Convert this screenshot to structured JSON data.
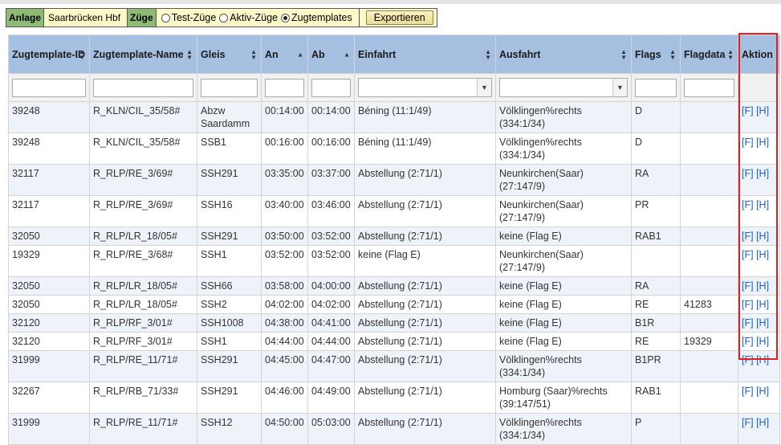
{
  "toolbar": {
    "anlage_label": "Anlage",
    "anlage_value": "Saarbrücken Hbf",
    "zuege_label": "Züge",
    "radio_test": "Test-Züge",
    "radio_aktiv": "Aktiv-Züge",
    "radio_templates": "Zugtemplates",
    "selected_radio": "Zugtemplates",
    "export_label": "Exportieren"
  },
  "table": {
    "headers": {
      "id": "Zugtemplate-ID",
      "name": "Zugtemplate-Name",
      "gleis": "Gleis",
      "an": "An",
      "ab": "Ab",
      "einfahrt": "Einfahrt",
      "ausfahrt": "Ausfahrt",
      "flags": "Flags",
      "flagdata": "Flagdata",
      "aktion": "Aktion"
    },
    "action_f": "[F]",
    "action_h": "[H]",
    "rows": [
      {
        "id": "39248",
        "name": "R_KLN/CIL_35/58#",
        "gleis": "Abzw Saardamm",
        "an": "00:14:00",
        "ab": "00:14:00",
        "einfahrt": "Béning (11:1/49)",
        "ausfahrt": "Völklingen%rechts (334:1/34)",
        "flags": "D",
        "flagdata": ""
      },
      {
        "id": "39248",
        "name": "R_KLN/CIL_35/58#",
        "gleis": "SSB1",
        "an": "00:16:00",
        "ab": "00:16:00",
        "einfahrt": "Béning (11:1/49)",
        "ausfahrt": "Völklingen%rechts (334:1/34)",
        "flags": "D",
        "flagdata": ""
      },
      {
        "id": "32117",
        "name": "R_RLP/RE_3/69#",
        "gleis": "SSH291",
        "an": "03:35:00",
        "ab": "03:37:00",
        "einfahrt": "Abstellung (2:71/1)",
        "ausfahrt": "Neunkirchen(Saar) (27:147/9)",
        "flags": "RA",
        "flagdata": ""
      },
      {
        "id": "32117",
        "name": "R_RLP/RE_3/69#",
        "gleis": "SSH16",
        "an": "03:40:00",
        "ab": "03:46:00",
        "einfahrt": "Abstellung (2:71/1)",
        "ausfahrt": "Neunkirchen(Saar) (27:147/9)",
        "flags": "PR",
        "flagdata": ""
      },
      {
        "id": "32050",
        "name": "R_RLP/LR_18/05#",
        "gleis": "SSH291",
        "an": "03:50:00",
        "ab": "03:52:00",
        "einfahrt": "Abstellung (2:71/1)",
        "ausfahrt": "keine (Flag E)",
        "flags": "RAB1",
        "flagdata": ""
      },
      {
        "id": "19329",
        "name": "R_RLP/RE_3/68#",
        "gleis": "SSH1",
        "an": "03:52:00",
        "ab": "03:52:00",
        "einfahrt": "keine (Flag E)",
        "ausfahrt": "Neunkirchen(Saar) (27:147/9)",
        "flags": "",
        "flagdata": ""
      },
      {
        "id": "32050",
        "name": "R_RLP/LR_18/05#",
        "gleis": "SSH66",
        "an": "03:58:00",
        "ab": "04:00:00",
        "einfahrt": "Abstellung (2:71/1)",
        "ausfahrt": "keine (Flag E)",
        "flags": "RA",
        "flagdata": ""
      },
      {
        "id": "32050",
        "name": "R_RLP/LR_18/05#",
        "gleis": "SSH2",
        "an": "04:02:00",
        "ab": "04:02:00",
        "einfahrt": "Abstellung (2:71/1)",
        "ausfahrt": "keine (Flag E)",
        "flags": "RE",
        "flagdata": "41283"
      },
      {
        "id": "32120",
        "name": "R_RLP/RF_3/01#",
        "gleis": "SSH1008",
        "an": "04:38:00",
        "ab": "04:41:00",
        "einfahrt": "Abstellung (2:71/1)",
        "ausfahrt": "keine (Flag E)",
        "flags": "B1R",
        "flagdata": ""
      },
      {
        "id": "32120",
        "name": "R_RLP/RF_3/01#",
        "gleis": "SSH1",
        "an": "04:44:00",
        "ab": "04:44:00",
        "einfahrt": "Abstellung (2:71/1)",
        "ausfahrt": "keine (Flag E)",
        "flags": "RE",
        "flagdata": "19329"
      },
      {
        "id": "31999",
        "name": "R_RLP/RE_11/71#",
        "gleis": "SSH291",
        "an": "04:45:00",
        "ab": "04:47:00",
        "einfahrt": "Abstellung (2:71/1)",
        "ausfahrt": "Völklingen%rechts (334:1/34)",
        "flags": "B1PR",
        "flagdata": ""
      },
      {
        "id": "32267",
        "name": "R_RLP/RB_71/33#",
        "gleis": "SSH291",
        "an": "04:46:00",
        "ab": "04:49:00",
        "einfahrt": "Abstellung (2:71/1)",
        "ausfahrt": "Homburg (Saar)%rechts (39:147/51)",
        "flags": "RAB1",
        "flagdata": ""
      },
      {
        "id": "31999",
        "name": "R_RLP/RE_11/71#",
        "gleis": "SSH12",
        "an": "04:50:00",
        "ab": "05:03:00",
        "einfahrt": "Abstellung (2:71/1)",
        "ausfahrt": "Völklingen%rechts (334:1/34)",
        "flags": "P",
        "flagdata": ""
      }
    ]
  },
  "colors": {
    "header_bg": "#a6c0e2",
    "label_bg": "#8dbb73",
    "toolbar_bg": "#fdf8c8",
    "link": "#1a5fc9",
    "highlight": "#e02020"
  }
}
